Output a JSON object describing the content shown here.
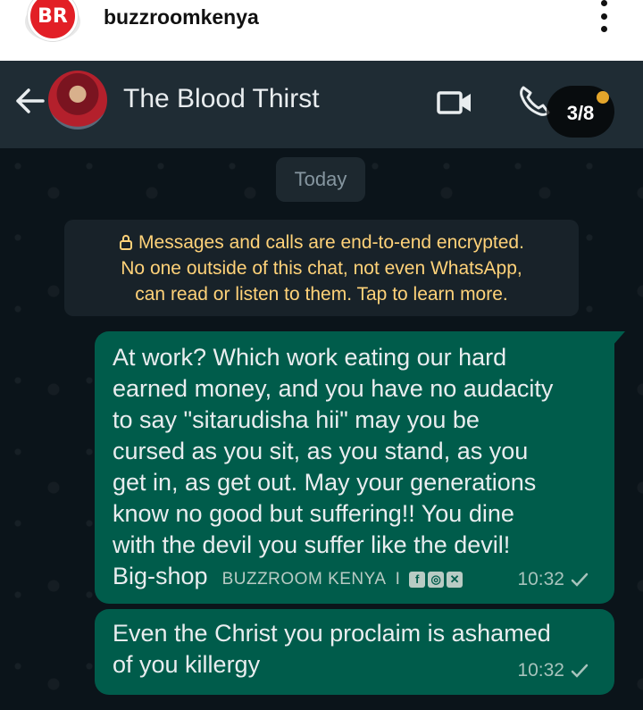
{
  "post_header": {
    "username": "buzzroomkenya",
    "logo_text": "BR"
  },
  "chat_header": {
    "contact_name": "The Blood Thirst",
    "page_counter": "3/8"
  },
  "chat": {
    "date_chip": "Today",
    "encryption_notice": [
      "Messages and calls are end-to-end encrypted.",
      "No one outside of this chat, not even WhatsApp,",
      "can read or listen to them. Tap to learn more."
    ],
    "messages": [
      {
        "lines": [
          "At work? Which work eating  our hard",
          "earned money, and you have no audacity",
          "to say \"sitarudisha hii\" may you be",
          "cursed as you sit, as you stand, as you",
          "get in, as get out. May your generations",
          "know no good but suffering!! You dine",
          "with the devil you suffer like the devil!",
          "Big-shop"
        ],
        "time": "10:32"
      },
      {
        "lines": [
          "Even the Christ you proclaim is ashamed",
          "of you killergy"
        ],
        "time": "10:32"
      }
    ],
    "watermark": {
      "text": "BUZZROOM KENYA",
      "separator": "I",
      "icons": [
        "facebook-icon",
        "instagram-icon",
        "x-icon"
      ]
    }
  },
  "colors": {
    "header_bg": "#1f2c34",
    "chat_bg": "#0b141a",
    "bubble_out": "#005c4b",
    "encryption_text": "#ffd279"
  }
}
